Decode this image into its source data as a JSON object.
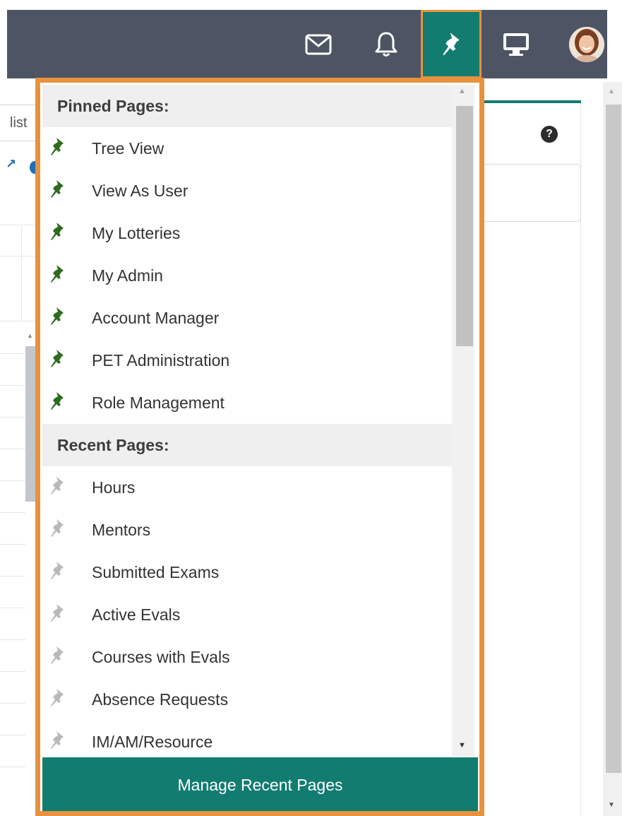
{
  "background": {
    "search_partial": "list"
  },
  "dropdown": {
    "pinned_header": "Pinned Pages:",
    "pinned": [
      {
        "label": "Tree View"
      },
      {
        "label": "View As User"
      },
      {
        "label": "My Lotteries"
      },
      {
        "label": "My Admin"
      },
      {
        "label": "Account Manager"
      },
      {
        "label": "PET Administration"
      },
      {
        "label": "Role Management"
      }
    ],
    "recent_header": "Recent Pages:",
    "recent": [
      {
        "label": "Hours"
      },
      {
        "label": "Mentors"
      },
      {
        "label": "Submitted Exams"
      },
      {
        "label": "Active Evals"
      },
      {
        "label": "Courses with Evals"
      },
      {
        "label": "Absence Requests"
      },
      {
        "label": "IM/AM/Resource"
      }
    ],
    "manage_label": "Manage Recent Pages"
  },
  "icons": {
    "mail": "mail-icon",
    "bell": "bell-icon",
    "pin": "pushpin-icon",
    "screen": "monitor-icon",
    "avatar": "user-avatar",
    "help": "help-icon"
  },
  "colors": {
    "topbar": "#4d5564",
    "accent_teal": "#127c70",
    "highlight_orange": "#e8923d",
    "pinned_pin": "#2f6b1f",
    "recent_pin": "#b9b9b9"
  }
}
